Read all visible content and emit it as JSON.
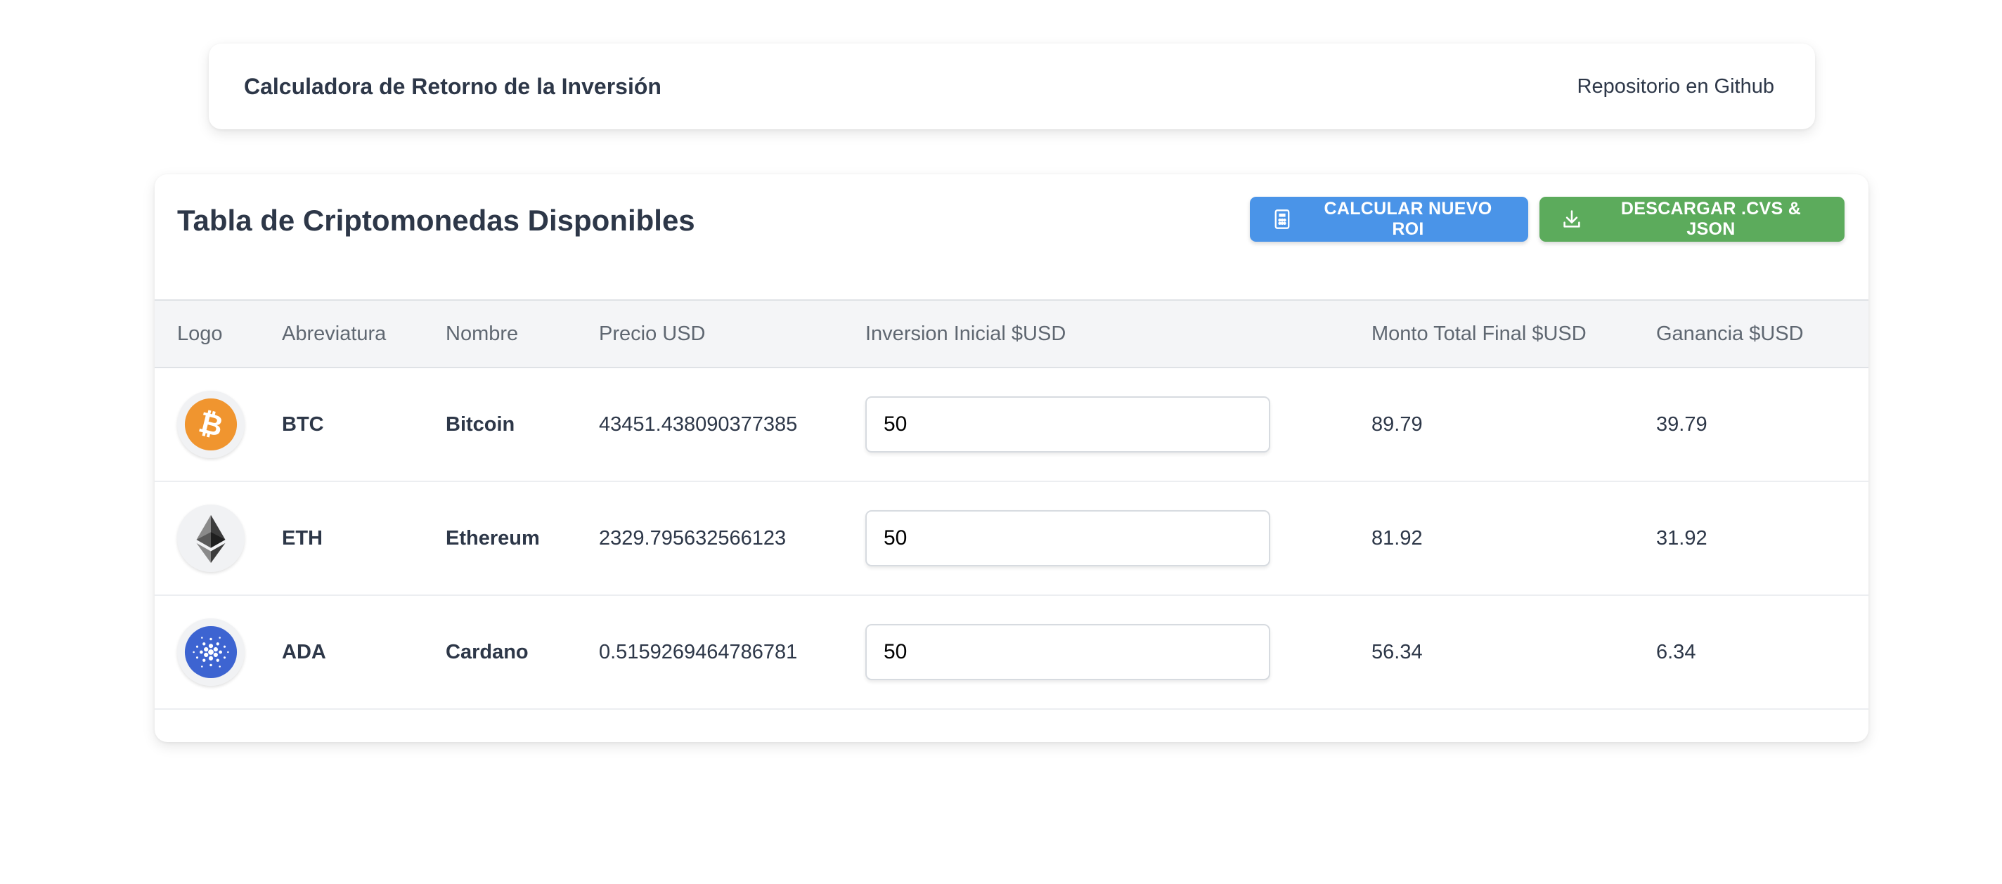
{
  "navbar": {
    "title": "Calculadora de Retorno de la Inversión",
    "repo_link": "Repositorio en Github"
  },
  "card": {
    "title": "Tabla de Criptomonedas Disponibles",
    "calc_button": "CALCULAR NUEVO ROI",
    "calc_icon": "calculator-icon",
    "download_button": "DESCARGAR .CVS & JSON",
    "download_icon": "download-icon",
    "colors": {
      "calc": "#4a94e8",
      "download": "#5cab5c"
    }
  },
  "table": {
    "headers": {
      "logo": "Logo",
      "abbr": "Abreviatura",
      "name": "Nombre",
      "price": "Precio USD",
      "investment": "Inversion Inicial $USD",
      "total": "Monto Total Final $USD",
      "gain": "Ganancia $USD"
    },
    "rows": [
      {
        "icon": "bitcoin-logo-icon",
        "abbr": "BTC",
        "name": "Bitcoin",
        "price": "43451.438090377385",
        "investment": "50",
        "total": "89.79",
        "gain": "39.79"
      },
      {
        "icon": "ethereum-logo-icon",
        "abbr": "ETH",
        "name": "Ethereum",
        "price": "2329.795632566123",
        "investment": "50",
        "total": "81.92",
        "gain": "31.92"
      },
      {
        "icon": "cardano-logo-icon",
        "abbr": "ADA",
        "name": "Cardano",
        "price": "0.5159269464786781",
        "investment": "50",
        "total": "56.34",
        "gain": "6.34"
      }
    ]
  }
}
